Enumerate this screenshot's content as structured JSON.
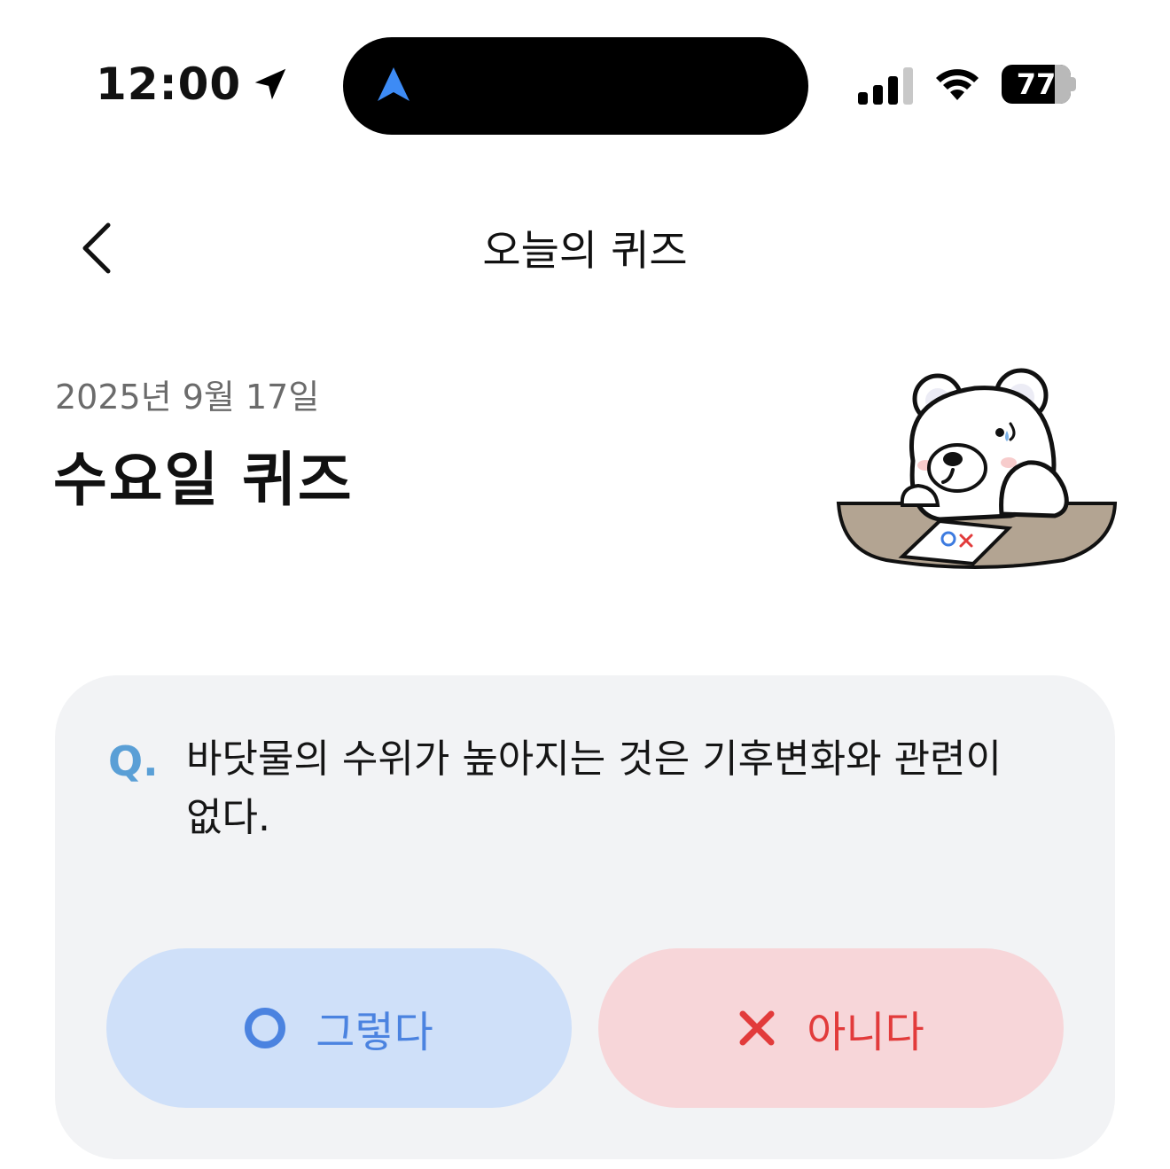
{
  "status_bar": {
    "time": "12:00",
    "battery": "77"
  },
  "header": {
    "title": "오늘의 퀴즈"
  },
  "quiz": {
    "date": "2025년 9월 17일",
    "title": "수요일 퀴즈",
    "question_marker": "Q.",
    "question": "바닷물의 수위가 높아지는 것은 기후변화와 관련이 없다.",
    "answers": {
      "yes": "그렇다",
      "no": "아니다"
    }
  },
  "illustration": {
    "ox_sheet": [
      "O",
      "X"
    ]
  },
  "colors": {
    "accent_blue": "#4b83e0",
    "accent_red": "#e23b3b",
    "card_bg": "#f2f3f5",
    "question_marker": "#5a9fd6"
  },
  "icons": [
    "location-arrow-icon",
    "navigation-icon",
    "cellular-signal-icon",
    "wifi-icon",
    "battery-icon",
    "chevron-left-icon",
    "circle-o-icon",
    "x-icon"
  ]
}
